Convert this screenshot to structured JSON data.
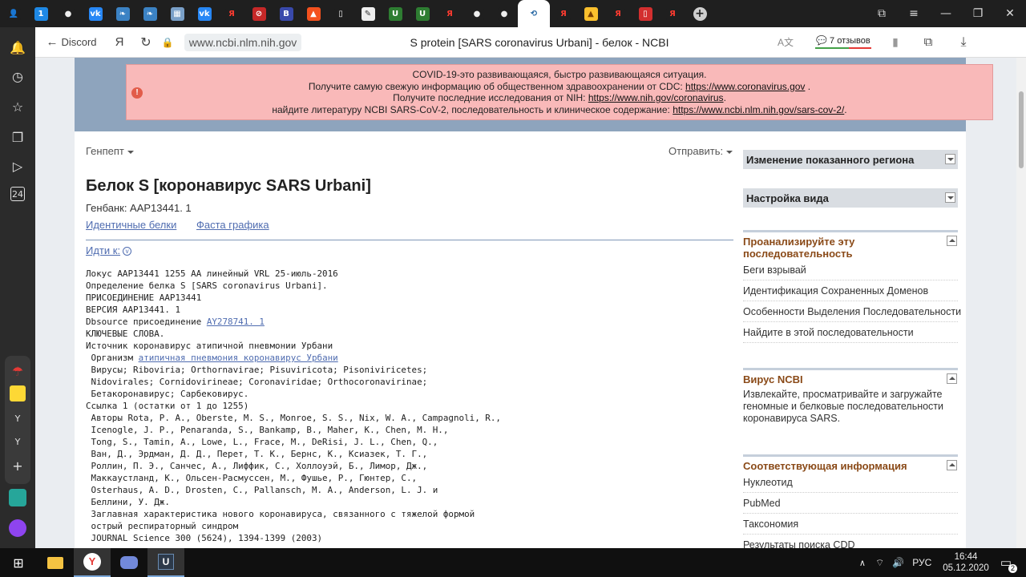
{
  "browser": {
    "tabs": [
      {
        "icon": "yandex-profile-icon",
        "glyph": "👤",
        "color": "#1f1f1f",
        "fg": "#ddd"
      },
      {
        "icon": "tab-counter-icon",
        "glyph": "1",
        "color": "#1e88e5",
        "fg": "#fff"
      },
      {
        "icon": "github-icon",
        "glyph": "●",
        "color": "#1f1f1f",
        "fg": "#eee"
      },
      {
        "icon": "vk-icon",
        "glyph": "vk",
        "color": "#2787f5",
        "fg": "#fff"
      },
      {
        "icon": "feather-icon",
        "glyph": "❧",
        "color": "#3b82c4",
        "fg": "#fff"
      },
      {
        "icon": "feather-icon",
        "glyph": "❧",
        "color": "#3b82c4",
        "fg": "#fff"
      },
      {
        "icon": "image-icon",
        "glyph": "▦",
        "color": "#7aa0c8",
        "fg": "#fff"
      },
      {
        "icon": "vk-icon",
        "glyph": "vk",
        "color": "#2787f5",
        "fg": "#fff"
      },
      {
        "icon": "yandex-icon",
        "glyph": "Я",
        "color": "#1f1f1f",
        "fg": "#ff3b30"
      },
      {
        "icon": "blocked-icon",
        "glyph": "⊘",
        "color": "#c62828",
        "fg": "#fff"
      },
      {
        "icon": "b-icon",
        "glyph": "B",
        "color": "#3949ab",
        "fg": "#fff"
      },
      {
        "icon": "orange-app-icon",
        "glyph": "▲",
        "color": "#f4511e",
        "fg": "#fff"
      },
      {
        "icon": "document-icon",
        "glyph": "▯",
        "color": "#1f1f1f",
        "fg": "#eee"
      },
      {
        "icon": "pencil-icon",
        "glyph": "✎",
        "color": "#eeeeee",
        "fg": "#333"
      },
      {
        "icon": "shield-icon",
        "glyph": "U",
        "color": "#2e7d32",
        "fg": "#fff"
      },
      {
        "icon": "shield-icon",
        "glyph": "U",
        "color": "#2e7d32",
        "fg": "#fff"
      },
      {
        "icon": "yandex-icon",
        "glyph": "Я",
        "color": "#1f1f1f",
        "fg": "#ff3b30"
      },
      {
        "icon": "github-icon",
        "glyph": "●",
        "color": "#1f1f1f",
        "fg": "#eee"
      },
      {
        "icon": "github-icon",
        "glyph": "●",
        "color": "#1f1f1f",
        "fg": "#eee"
      },
      {
        "icon": "ncbi-icon",
        "glyph": "⟲",
        "color": "#ffffff",
        "fg": "#1a5e9e"
      },
      {
        "icon": "yandex-icon",
        "glyph": "Я",
        "color": "#1f1f1f",
        "fg": "#ff3b30"
      },
      {
        "icon": "image-icon",
        "glyph": "▲",
        "color": "#fbc02d",
        "fg": "#7b3f00"
      },
      {
        "icon": "yandex-icon",
        "glyph": "Я",
        "color": "#1f1f1f",
        "fg": "#ff3b30"
      },
      {
        "icon": "pdf-icon",
        "glyph": "▯",
        "color": "#d32f2f",
        "fg": "#fff"
      },
      {
        "icon": "yandex-icon",
        "glyph": "Я",
        "color": "#1f1f1f",
        "fg": "#ff3b30"
      }
    ],
    "new_tab_glyph": "+",
    "address": {
      "back_label": "Discord",
      "yandex_glyph": "Я",
      "url": "www.ncbi.nlm.nih.gov",
      "page_title": "S protein [SARS coronavirus Urbani] - белок - NCBI",
      "reviews": "7 отзывов"
    },
    "left_sidebar": {
      "badge": "24",
      "items": [
        "Y",
        "Y"
      ]
    }
  },
  "alert": {
    "lines": [
      {
        "text": "COVID-19-это развивающаяся, быстро развивающаяся ситуация.",
        "link": ""
      },
      {
        "text": "Получите самую свежую информацию об общественном здравоохранении от CDC: ",
        "link": "https://www.coronavirus.gov",
        "after": " ."
      },
      {
        "text": "Получите последние исследования от NIH: ",
        "link": "https://www.nih.gov/coronavirus",
        "after": "."
      },
      {
        "text": "найдите литературу NCBI SARS-CoV-2, последовательность и клиническое содержание: ",
        "link": "https://www.ncbi.nlm.nih.gov/sars-cov-2/",
        "after": "."
      }
    ]
  },
  "page": {
    "format_label": "Генпепт",
    "send_label": "Отправить:",
    "title": "Белок S [коронавирус SARS Urbani]",
    "genbank": "Генбанк: AAP13441. 1",
    "links": [
      "Идентичные белки",
      "Фаста графика"
    ],
    "goto": "Идти к:",
    "record": [
      {
        "t": "Локус AAP13441 1255 AA линейный VRL 25-июль-2016"
      },
      {
        "t": "Определение белка S [SARS coronavirus Urbani]."
      },
      {
        "t": "ПРИСОЕДИНЕНИЕ AAP13441"
      },
      {
        "t": "ВЕРСИЯ AAP13441. 1"
      },
      {
        "t": "Dbsource присоединение ",
        "link": "AY278741. 1"
      },
      {
        "t": "КЛЮЧЕВЫЕ СЛОВА."
      },
      {
        "t": "Источник коронавирус атипичной пневмонии Урбани"
      },
      {
        "t": " Организм ",
        "link": "атипичная пневмония коронавирус Урбани"
      },
      {
        "t": " Вирусы; Riboviria; Orthornavirae; Pisuviricota; Pisoniviricetes;"
      },
      {
        "t": " Nidovirales; Cornidovirineae; Coronaviridae; Orthocoronavirinae;"
      },
      {
        "t": " Бетакоронавирус; Сарбековирус."
      },
      {
        "t": "Ссылка 1 (остатки от 1 до 1255)"
      },
      {
        "t": " Авторы Rota, P. A., Oberste, M. S., Monroe, S. S., Nix, W. A., Campagnoli, R.,"
      },
      {
        "t": " Icenogle, J. P., Penaranda, S., Bankamp, B., Maher, K., Chen, M. H.,"
      },
      {
        "t": " Tong, S., Tamin, A., Lowe, L., Frace, M., DeRisi, J. L., Chen, Q.,"
      },
      {
        "t": " Ван, Д., Эрдман, Д. Д., Перет, Т. К., Бернс, К., Ксиазек, Т. Г.,"
      },
      {
        "t": " Роллин, П. Э., Санчес, А., Лиффик, С., Холлоуэй, Б., Лимор, Дж.,"
      },
      {
        "t": " Маккаустланд, К., Ольсен-Расмуссен, М., Фушье, Р., Гюнтер, С.,"
      },
      {
        "t": " Osterhaus, A. D., Drosten, C., Pallansch, M. A., Anderson, L. J. и"
      },
      {
        "t": " Беллини, У. Дж."
      },
      {
        "t": " Заглавная характеристика нового коронавируса, связанного с тяжелой формой"
      },
      {
        "t": " острый респираторный синдром"
      },
      {
        "t": " JOURNAL Science 300 (5624), 1394-1399 (2003)"
      }
    ]
  },
  "right": {
    "change_region": "Изменение показанного региона",
    "view_settings": "Настройка вида",
    "analyze": {
      "title": "Проанализируйте эту последовательность",
      "links": [
        "Беги взрывай",
        "Идентификация Сохраненных Доменов",
        "Особенности Выделения Последовательности",
        "Найдите в этой последовательности"
      ]
    },
    "virus": {
      "title": "Вирус NCBI",
      "desc": "Извлекайте, просматривайте и загружайте геномные и белковые последовательности коронавируса SARS."
    },
    "related": {
      "title": "Соответствующая информация",
      "links": [
        "Нуклеотид",
        "PubMed",
        "Таксономия",
        "Результаты поиска CDD"
      ]
    }
  },
  "taskbar": {
    "tray_lang": "РУС",
    "time": "16:44",
    "date": "05.12.2020",
    "notif_count": "2"
  }
}
